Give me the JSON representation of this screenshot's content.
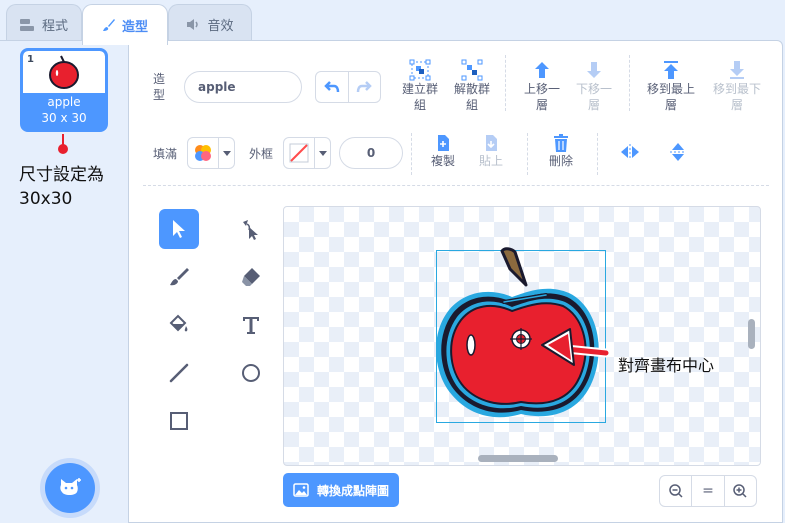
{
  "tabs": [
    {
      "label": "程式",
      "icon": "code-blocks-icon"
    },
    {
      "label": "造型",
      "icon": "paintbrush-icon"
    },
    {
      "label": "音效",
      "icon": "speaker-icon"
    }
  ],
  "costume_list": {
    "items": [
      {
        "index": "1",
        "name": "apple",
        "size": "30 x 30"
      }
    ]
  },
  "annotations": {
    "left_note_line1": "尺寸設定為",
    "left_note_line2": "30x30",
    "right_note": "對齊畫布中心",
    "accent_color": "#e8202e"
  },
  "editor": {
    "costume_label": "造型",
    "costume_name": "apple",
    "group_label": "建立群組",
    "ungroup_label": "解散群組",
    "forward_label": "上移一層",
    "backward_label": "下移一層",
    "front_label": "移到最上層",
    "back_label": "移到最下層",
    "fill_label": "填滿",
    "outline_label": "外框",
    "outline_width": "0",
    "copy_label": "複製",
    "paste_label": "貼上",
    "delete_label": "刪除",
    "convert_label": "轉換成點陣圖"
  },
  "tools": [
    "select-tool",
    "reshape-tool",
    "brush-tool",
    "eraser-tool",
    "fill-tool",
    "text-tool",
    "line-tool",
    "circle-tool",
    "rectangle-tool"
  ],
  "zoom": {
    "out": "−",
    "reset": "=",
    "in": "+"
  },
  "colors": {
    "accent": "#4d97ff",
    "apple_fill": "#e8202e",
    "apple_stroke": "#1a1a2e",
    "apple_outer": "#29a8e0",
    "stem": "#8b6a3e"
  }
}
